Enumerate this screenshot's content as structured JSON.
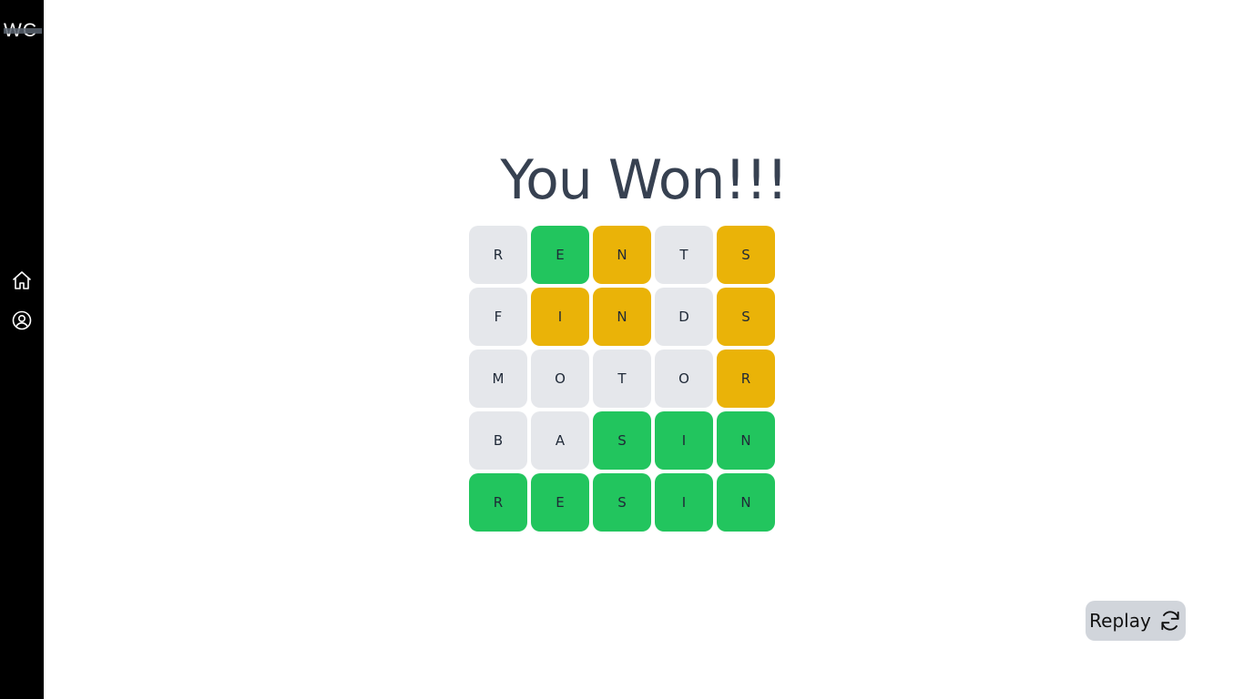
{
  "app": {
    "logo_text": "WC"
  },
  "sidebar": {
    "items": [
      {
        "icon": "home-icon"
      },
      {
        "icon": "user-circle-icon"
      }
    ]
  },
  "main": {
    "title": "You Won!!!",
    "replay_label": "Replay",
    "replay_icon": "refresh-icon"
  },
  "colors": {
    "correct": "#22c55e",
    "present": "#eab308",
    "absent": "#e5e7eb"
  },
  "board": {
    "rows": [
      [
        {
          "letter": "R",
          "status": "absent"
        },
        {
          "letter": "E",
          "status": "correct"
        },
        {
          "letter": "N",
          "status": "present"
        },
        {
          "letter": "T",
          "status": "absent"
        },
        {
          "letter": "S",
          "status": "present"
        }
      ],
      [
        {
          "letter": "F",
          "status": "absent"
        },
        {
          "letter": "I",
          "status": "present"
        },
        {
          "letter": "N",
          "status": "present"
        },
        {
          "letter": "D",
          "status": "absent"
        },
        {
          "letter": "S",
          "status": "present"
        }
      ],
      [
        {
          "letter": "M",
          "status": "absent"
        },
        {
          "letter": "O",
          "status": "absent"
        },
        {
          "letter": "T",
          "status": "absent"
        },
        {
          "letter": "O",
          "status": "absent"
        },
        {
          "letter": "R",
          "status": "present"
        }
      ],
      [
        {
          "letter": "B",
          "status": "absent"
        },
        {
          "letter": "A",
          "status": "absent"
        },
        {
          "letter": "S",
          "status": "correct"
        },
        {
          "letter": "I",
          "status": "correct"
        },
        {
          "letter": "N",
          "status": "correct"
        }
      ],
      [
        {
          "letter": "R",
          "status": "correct"
        },
        {
          "letter": "E",
          "status": "correct"
        },
        {
          "letter": "S",
          "status": "correct"
        },
        {
          "letter": "I",
          "status": "correct"
        },
        {
          "letter": "N",
          "status": "correct"
        }
      ]
    ]
  }
}
